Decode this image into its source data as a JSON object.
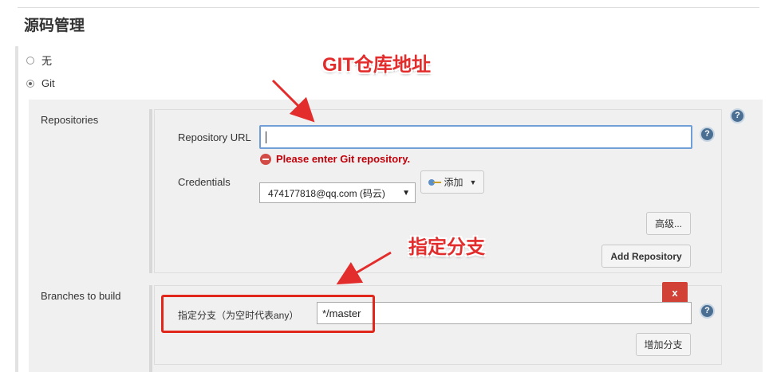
{
  "section": {
    "title": "源码管理"
  },
  "scm_options": [
    {
      "label": "无",
      "selected": false
    },
    {
      "label": "Git",
      "selected": true
    }
  ],
  "repositories": {
    "label": "Repositories",
    "url_label": "Repository URL",
    "url_value": "",
    "error": "Please enter Git repository.",
    "credentials_label": "Credentials",
    "credentials_value": "474177818@qq.com (码云)",
    "add_button": "添加",
    "advanced_button": "高级...",
    "add_repository_button": "Add Repository"
  },
  "branches": {
    "label": "Branches to build",
    "delete_button": "x",
    "branch_label": "指定分支（为空时代表any）",
    "branch_value": "*/master",
    "add_branch_button": "增加分支"
  },
  "annotations": {
    "git_url": "GIT仓库地址",
    "branch": "指定分支"
  },
  "help_icon": "?",
  "colors": {
    "error": "#c4000a",
    "annotation": "#e32c2c",
    "delete_button": "#d24136",
    "help_icon": "#4a6f93"
  }
}
